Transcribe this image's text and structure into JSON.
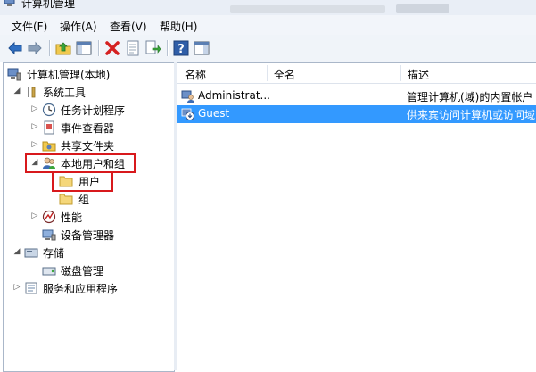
{
  "window": {
    "title": "计算机管理"
  },
  "menu": [
    {
      "label": "文件(F)"
    },
    {
      "label": "操作(A)"
    },
    {
      "label": "查看(V)"
    },
    {
      "label": "帮助(H)"
    }
  ],
  "toolbar": {
    "buttons": [
      "back-icon",
      "forward-icon",
      "up-folder-icon",
      "show-hide-tree-icon",
      "delete-icon",
      "properties-icon",
      "export-list-icon",
      "help-icon",
      "show-hide-action-pane-icon"
    ]
  },
  "tree": {
    "root": "计算机管理(本地)",
    "system_tools": "系统工具",
    "task_scheduler": "任务计划程序",
    "event_viewer": "事件查看器",
    "shared_folders": "共享文件夹",
    "local_users_groups": "本地用户和组",
    "users": "用户",
    "groups": "组",
    "performance": "性能",
    "device_manager": "设备管理器",
    "storage": "存储",
    "disk_management": "磁盘管理",
    "services_apps": "服务和应用程序"
  },
  "list": {
    "columns": [
      "名称",
      "全名",
      "描述"
    ],
    "rows": [
      {
        "name": "Administrat...",
        "full_name": "",
        "description": "管理计算机(域)的内置帐户"
      },
      {
        "name": "Guest",
        "full_name": "",
        "description": "供来宾访问计算机或访问域"
      }
    ]
  },
  "colors": {
    "selection": "#3399ff",
    "highlight_box": "#d8191c"
  }
}
